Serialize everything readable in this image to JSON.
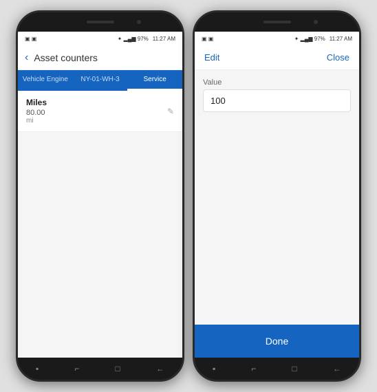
{
  "phone1": {
    "statusBar": {
      "left": "▣ ▣",
      "signal": "✦ ▂▄▆ 97%",
      "time": "11:27 AM"
    },
    "navBar": {
      "backIcon": "‹",
      "title": "Asset counters"
    },
    "tabs": [
      {
        "label": "Vehicle Engine",
        "active": false
      },
      {
        "label": "NY-01-WH-3",
        "active": false
      },
      {
        "label": "Service",
        "active": true
      }
    ],
    "listItems": [
      {
        "title": "Miles",
        "value": "80.00",
        "unit": "mi"
      }
    ],
    "bottomButtons": [
      "▪",
      "⌐",
      "□",
      "←"
    ]
  },
  "phone2": {
    "statusBar": {
      "left": "▣ ▣",
      "signal": "✦ ▂▄▆ 97%",
      "time": "11:27 AM"
    },
    "navBar": {
      "editLabel": "Edit",
      "closeLabel": "Close"
    },
    "field": {
      "label": "Value",
      "value": "100"
    },
    "doneButton": "Done",
    "bottomButtons": [
      "▪",
      "⌐",
      "□",
      "←"
    ]
  }
}
